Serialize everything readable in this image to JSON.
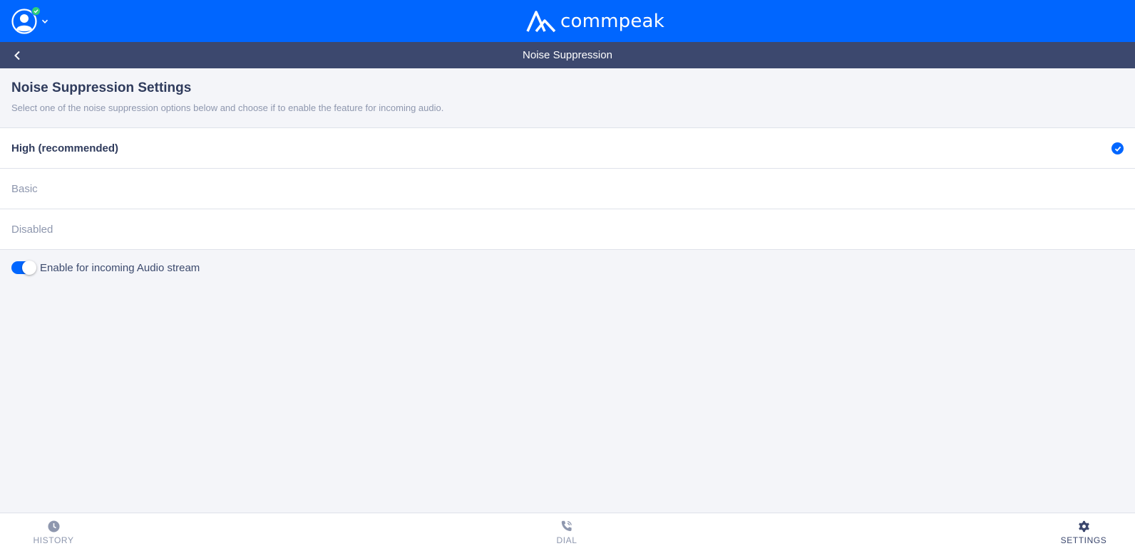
{
  "header": {
    "brand_name": "commpeak"
  },
  "subheader": {
    "title": "Noise Suppression"
  },
  "settings": {
    "title": "Noise Suppression Settings",
    "subtitle": "Select one of the noise suppression options below and choose if to enable the feature for incoming audio.",
    "options": [
      {
        "label": "High (recommended)",
        "selected": true
      },
      {
        "label": "Basic",
        "selected": false
      },
      {
        "label": "Disabled",
        "selected": false
      }
    ],
    "incoming_toggle": {
      "label": "Enable for incoming Audio stream",
      "enabled": true
    }
  },
  "bottom_nav": {
    "items": [
      {
        "label": "HISTORY",
        "icon": "clock-icon"
      },
      {
        "label": "DIAL",
        "icon": "phone-icon"
      },
      {
        "label": "SETTINGS",
        "icon": "gear-icon",
        "active": true
      }
    ]
  },
  "colors": {
    "primary": "#0066ff",
    "subheader_bg": "#3c486e",
    "page_bg": "#f4f5f9",
    "status_online": "#2fcf7a"
  }
}
